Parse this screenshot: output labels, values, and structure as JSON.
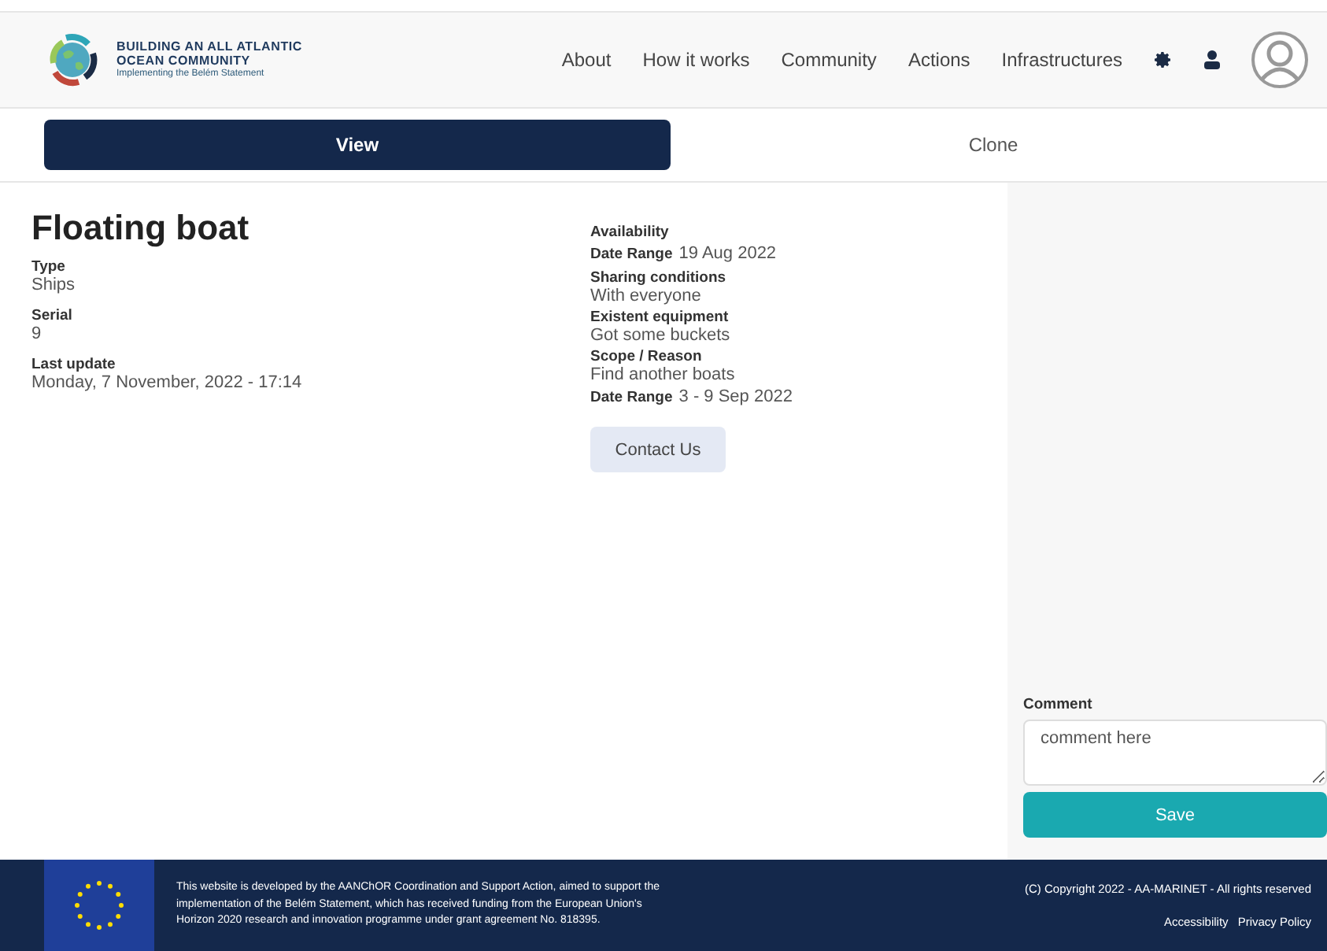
{
  "logo": {
    "line1": "BUILDING AN ALL ATLANTIC",
    "line2": "OCEAN COMMUNITY",
    "tagline": "Implementing the Belém Statement"
  },
  "nav": [
    "About",
    "How it works",
    "Community",
    "Actions",
    "Infrastructures"
  ],
  "tabs": [
    {
      "label": "View",
      "selected": true
    },
    {
      "label": "Clone",
      "selected": false
    }
  ],
  "item": {
    "title": "Floating boat",
    "fields": [
      {
        "label": "Type",
        "value": "Ships"
      },
      {
        "label": "Serial",
        "value": "9"
      },
      {
        "label": "Last update",
        "value": "Monday, 7 November, 2022 - 17:14"
      }
    ]
  },
  "availability": [
    {
      "kind": "heading",
      "label": "Availability"
    },
    {
      "kind": "inline",
      "label": "Date Range",
      "value": "19 Aug 2022"
    },
    {
      "kind": "stacked",
      "label": "Sharing conditions",
      "value": "With everyone"
    },
    {
      "kind": "stacked",
      "label": "Existent equipment",
      "value": "Got some buckets"
    },
    {
      "kind": "stacked",
      "label": "Scope / Reason",
      "value": "Find another boats"
    },
    {
      "kind": "inline",
      "label": "Date Range",
      "value": "3 - 9 Sep 2022"
    }
  ],
  "contact_button": "Contact Us",
  "comment": {
    "label": "Comment",
    "placeholder": "comment here",
    "button": "Save"
  },
  "footer": {
    "text": "This website is developed by the AANChOR Coordination and Support Action, aimed to support the implementation of the Belém Statement, which has received funding from the European Union's Horizon 2020 research and innovation programme under grant agreement No. 818395.",
    "copyright": "(C) Copyright 2022 - AA-MARINET - All rights reserved",
    "links": [
      "Accessibility",
      "Privacy Policy"
    ]
  }
}
